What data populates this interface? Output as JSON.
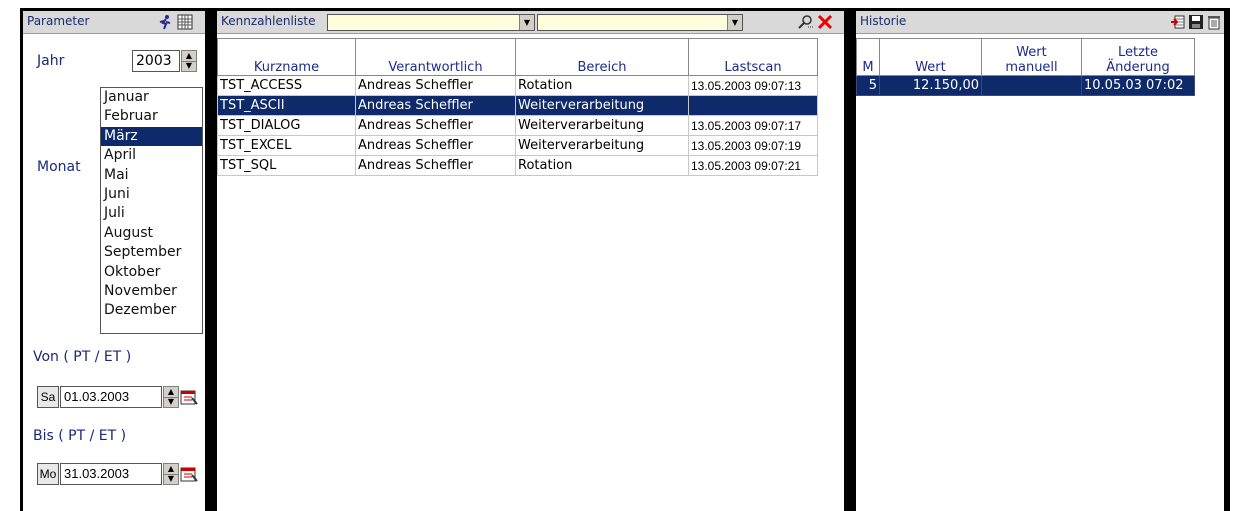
{
  "parameter": {
    "title": "Parameter",
    "jahr_label": "Jahr",
    "jahr_value": "2003",
    "monat_label": "Monat",
    "months": [
      "Januar",
      "Februar",
      "März",
      "April",
      "Mai",
      "Juni",
      "Juli",
      "August",
      "September",
      "Oktober",
      "November",
      "Dezember"
    ],
    "selected_month_index": 2,
    "von_label": "Von ( PT / ET )",
    "von_dow": "Sa",
    "von_date": "01.03.2003",
    "bis_label": "Bis ( PT / ET )",
    "bis_dow": "Mo",
    "bis_date": "31.03.2003"
  },
  "kennzahlen": {
    "title": "Kennzahlenliste",
    "filter1_value": "",
    "filter2_value": "",
    "columns": [
      "Kurzname",
      "Verantwortlich",
      "Bereich",
      "Lastscan"
    ],
    "rows": [
      {
        "kurzname": "TST_ACCESS",
        "verantwortlich": "Andreas Scheffler",
        "bereich": "Rotation",
        "lastscan": "13.05.2003 09:07:13"
      },
      {
        "kurzname": "TST_ASCII",
        "verantwortlich": "Andreas Scheffler",
        "bereich": "Weiterverarbeitung",
        "lastscan": ""
      },
      {
        "kurzname": "TST_DIALOG",
        "verantwortlich": "Andreas Scheffler",
        "bereich": "Weiterverarbeitung",
        "lastscan": "13.05.2003 09:07:17"
      },
      {
        "kurzname": "TST_EXCEL",
        "verantwortlich": "Andreas Scheffler",
        "bereich": "Weiterverarbeitung",
        "lastscan": "13.05.2003 09:07:19"
      },
      {
        "kurzname": "TST_SQL",
        "verantwortlich": "Andreas Scheffler",
        "bereich": "Rotation",
        "lastscan": "13.05.2003 09:07:21"
      }
    ],
    "selected_row_index": 1
  },
  "historie": {
    "title": "Historie",
    "columns": [
      "M",
      "Wert",
      "Wert manuell",
      "Letzte Änderung"
    ],
    "rows": [
      {
        "m": "5",
        "wert": "12.150,00",
        "wert_manuell": "",
        "letzte_aenderung": "10.05.03 07:02"
      }
    ]
  },
  "colors": {
    "selection": "#0e2a6b",
    "label": "#1a2a78",
    "combo_bg": "#fffedc",
    "titlebar": "#d9d9d9"
  }
}
